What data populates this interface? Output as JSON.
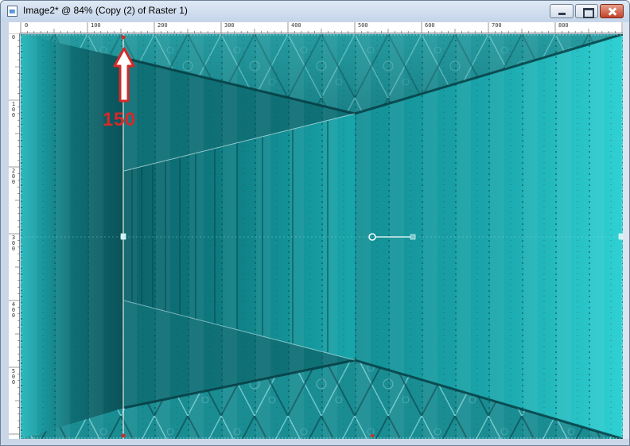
{
  "window": {
    "title": "Image2* @  84% (Copy (2) of Raster 1)",
    "icons": {
      "app": "image-file-icon",
      "minimize": "minimize-icon",
      "maximize": "maximize-icon",
      "close": "close-icon"
    }
  },
  "ruler_top": {
    "labels": [
      "0",
      "100",
      "200",
      "300",
      "400",
      "500",
      "600",
      "700",
      "800"
    ]
  },
  "ruler_left": {
    "labels": [
      "0",
      "100",
      "200",
      "300",
      "400",
      "500"
    ]
  },
  "annotation": {
    "label": "150",
    "icon": "arrow-up-icon",
    "color": "#d42a2a"
  },
  "colors": {
    "teal_dark": "#0b5a60",
    "teal_mid": "#138f95",
    "teal_light": "#2ec8cc",
    "accent_red": "#d42a2a"
  }
}
